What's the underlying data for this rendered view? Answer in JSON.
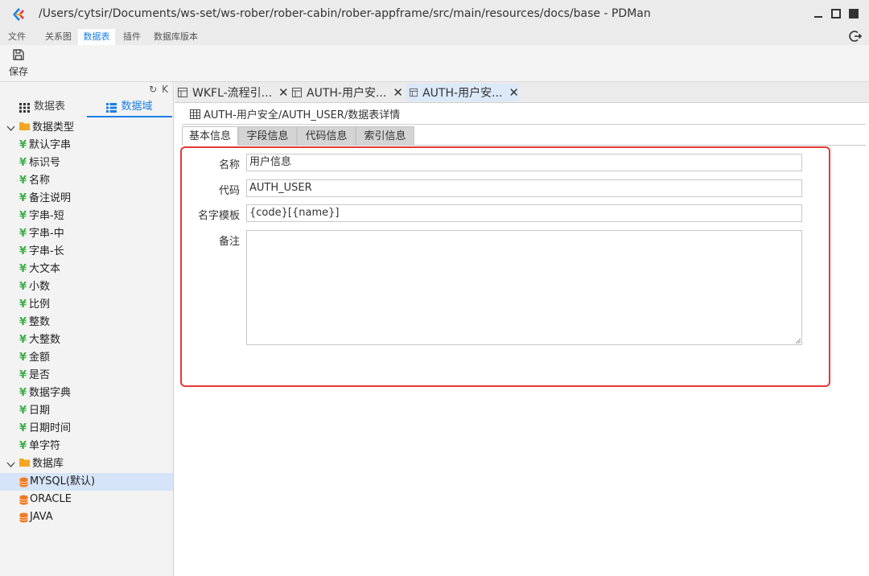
{
  "window": {
    "title": "/Users/cytsir/Documents/ws-set/ws-rober/rober-cabin/rober-appframe/src/main/resources/docs/base - PDMan"
  },
  "menubar": {
    "items": [
      "文件",
      "关系图",
      "数据表",
      "插件",
      "数据库版本"
    ],
    "active_index": 2
  },
  "toolbar": {
    "save_label": "保存"
  },
  "left_panel": {
    "tools": [
      "↻",
      "K"
    ],
    "tabs": [
      {
        "label": "数据表",
        "icon": "grid-icon"
      },
      {
        "label": "数据域",
        "icon": "list-icon"
      }
    ],
    "active_tab": 1,
    "tree": {
      "group1": {
        "label": "数据类型",
        "items": [
          "默认字串",
          "标识号",
          "名称",
          "备注说明",
          "字串-短",
          "字串-中",
          "字串-长",
          "大文本",
          "小数",
          "比例",
          "整数",
          "大整数",
          "金额",
          "是否",
          "数据字典",
          "日期",
          "日期时间",
          "单字符"
        ]
      },
      "group2": {
        "label": "数据库",
        "items": [
          "MYSQL(默认)",
          "ORACLE",
          "JAVA"
        ],
        "selected_index": 0
      }
    }
  },
  "doc_tabs": [
    {
      "label": "WKFL-流程引..."
    },
    {
      "label": "AUTH-用户安..."
    },
    {
      "label": "AUTH-用户安..."
    }
  ],
  "active_doc_tab": 2,
  "breadcrumb": "AUTH-用户安全/AUTH_USER/数据表详情",
  "sub_tabs": [
    "基本信息",
    "字段信息",
    "代码信息",
    "索引信息"
  ],
  "active_sub_tab": 0,
  "form": {
    "name_label": "名称",
    "name_value": "用户信息",
    "code_label": "代码",
    "code_value": "AUTH_USER",
    "template_label": "名字模板",
    "template_value": "{code}[{name}]",
    "remark_label": "备注",
    "remark_value": ""
  },
  "colors": {
    "accent": "#1a7fe5",
    "highlight_border": "#e53935",
    "tree_icon_green": "#3fb04a",
    "folder_orange": "#f5a623"
  }
}
